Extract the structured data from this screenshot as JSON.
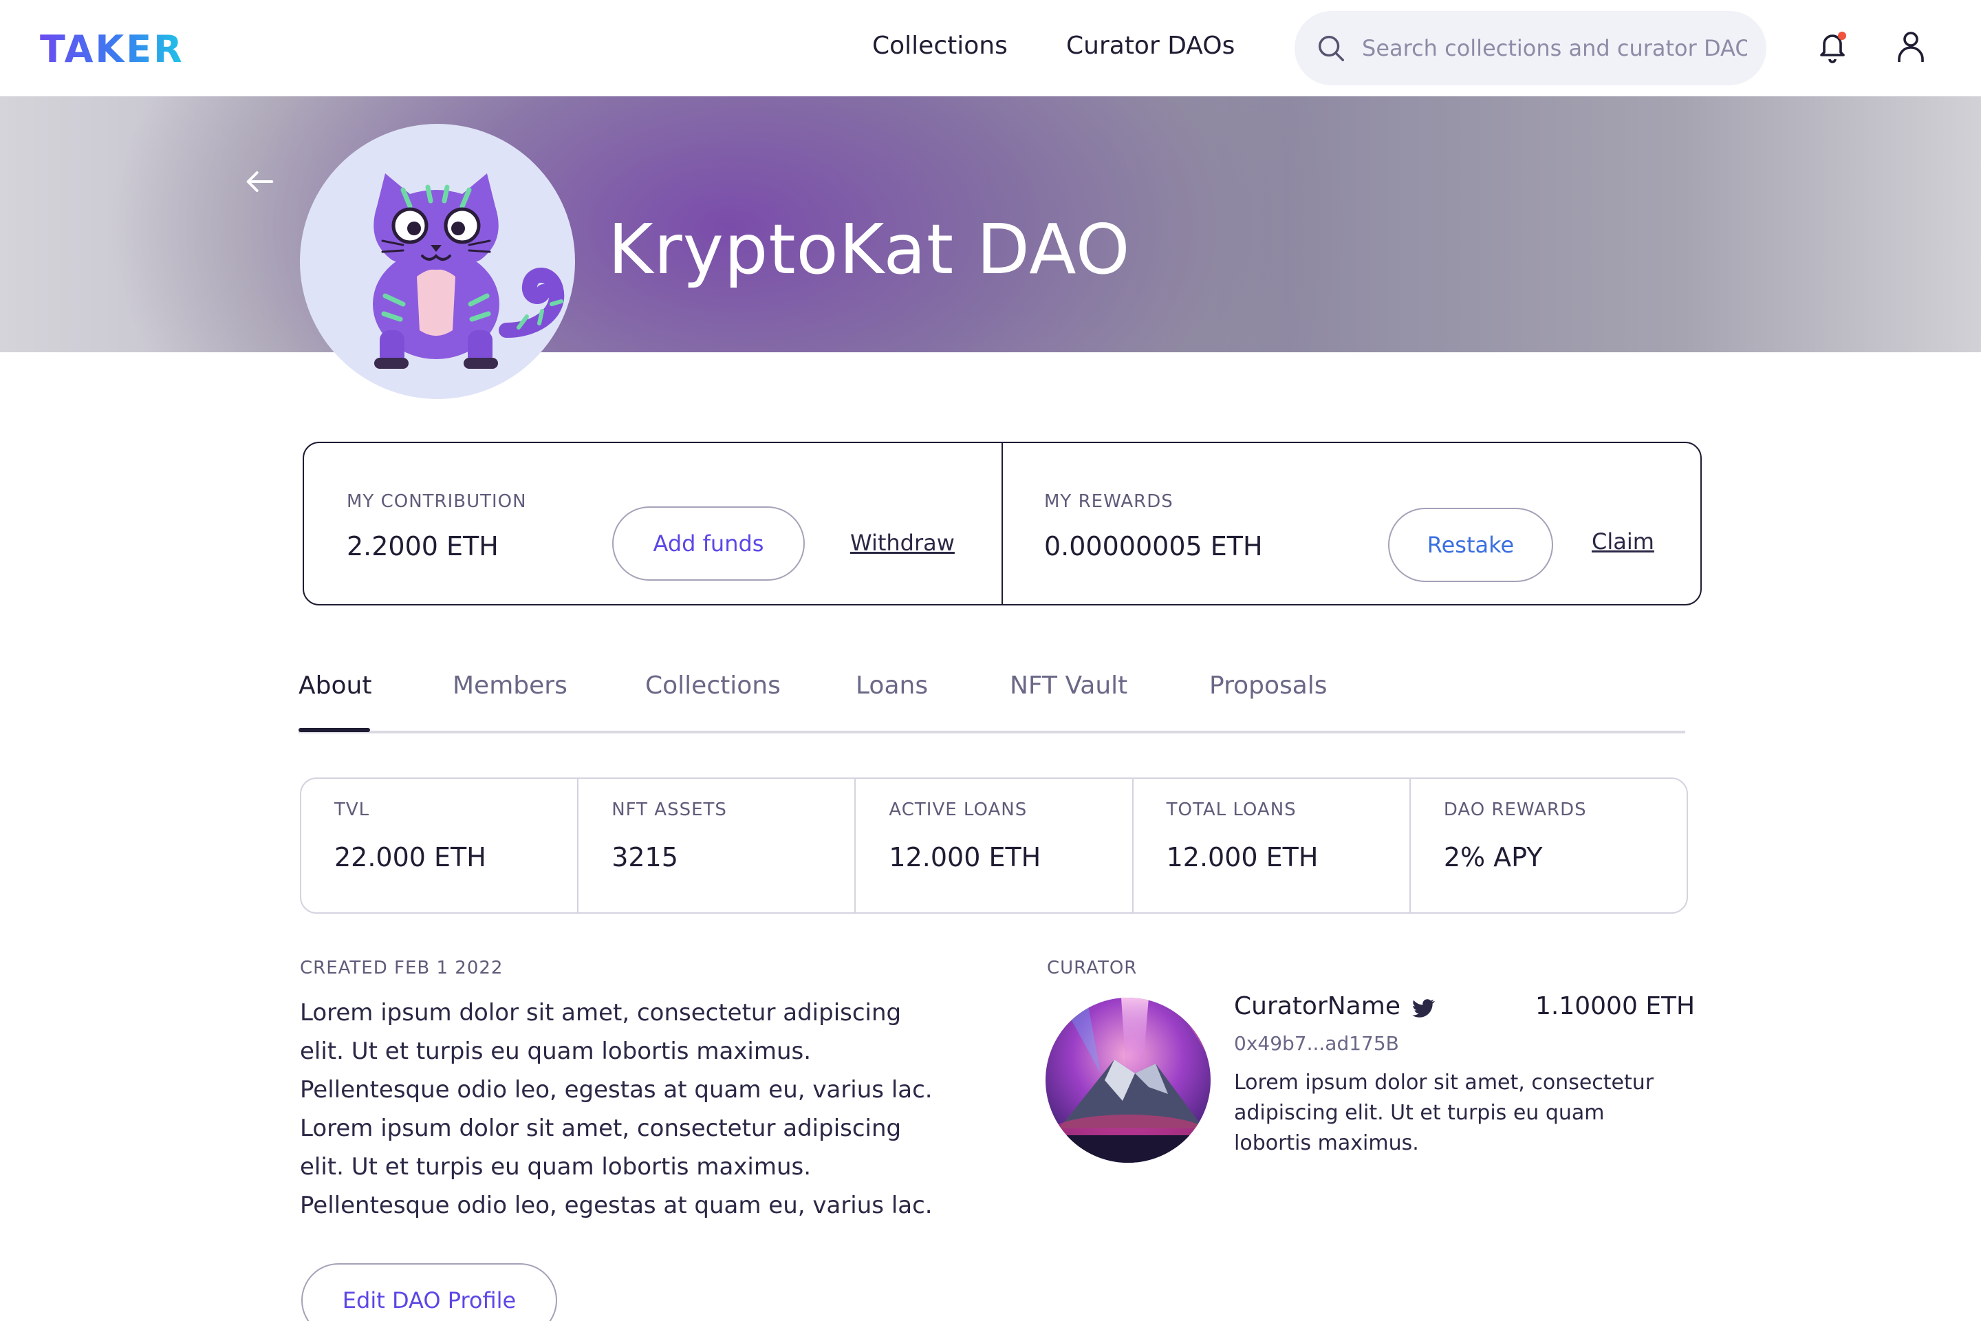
{
  "header": {
    "logo": "TAKER",
    "nav": {
      "collections": "Collections",
      "curator_daos": "Curator DAOs"
    },
    "search": {
      "placeholder": "Search collections and curator DAOs",
      "icon": "search-icon"
    },
    "icons": {
      "notifications": "bell-icon",
      "profile": "user-icon"
    }
  },
  "banner": {
    "title": "KryptoKat DAO"
  },
  "contribution": {
    "label": "MY CONTRIBUTION",
    "value": "2.2000 ETH",
    "add_funds": "Add funds",
    "withdraw": "Withdraw"
  },
  "rewards": {
    "label": "MY REWARDS",
    "value": "0.00000005 ETH",
    "restake": "Restake",
    "claim": "Claim"
  },
  "tabs": [
    {
      "label": "About",
      "active": true
    },
    {
      "label": "Members"
    },
    {
      "label": "Collections"
    },
    {
      "label": "Loans"
    },
    {
      "label": "NFT Vault"
    },
    {
      "label": "Proposals"
    }
  ],
  "stats": [
    {
      "label": "TVL",
      "value": "22.000 ETH"
    },
    {
      "label": "NFT ASSETS",
      "value": "3215"
    },
    {
      "label": "ACTIVE LOANS",
      "value": "12.000 ETH"
    },
    {
      "label": "TOTAL LOANS",
      "value": "12.000 ETH"
    },
    {
      "label": "DAO REWARDS",
      "value": "2% APY"
    }
  ],
  "about": {
    "created": "CREATED FEB 1 2022",
    "text": "Lorem ipsum dolor sit amet, consectetur adipiscing elit. Ut et turpis eu quam lobortis maximus. Pellentesque odio leo, egestas at quam eu, varius lac. Lorem ipsum dolor sit amet, consectetur adipiscing elit. Ut et turpis eu quam lobortis maximus. Pellentesque odio leo, egestas at quam eu, varius lac.",
    "edit_button": "Edit DAO Profile"
  },
  "curator": {
    "label": "CURATOR",
    "name": "CuratorName",
    "eth": "1.10000 ETH",
    "address": "0x49b7...ad175B",
    "bio": "Lorem ipsum dolor sit amet, consectetur adipiscing elit. Ut et turpis eu quam lobortis maximus."
  },
  "colors": {
    "accent": "#5b47e6",
    "text": "#1f1d33",
    "muted": "#6a6887",
    "border": "#d4d3e0",
    "notification_dot": "#f0523d"
  }
}
